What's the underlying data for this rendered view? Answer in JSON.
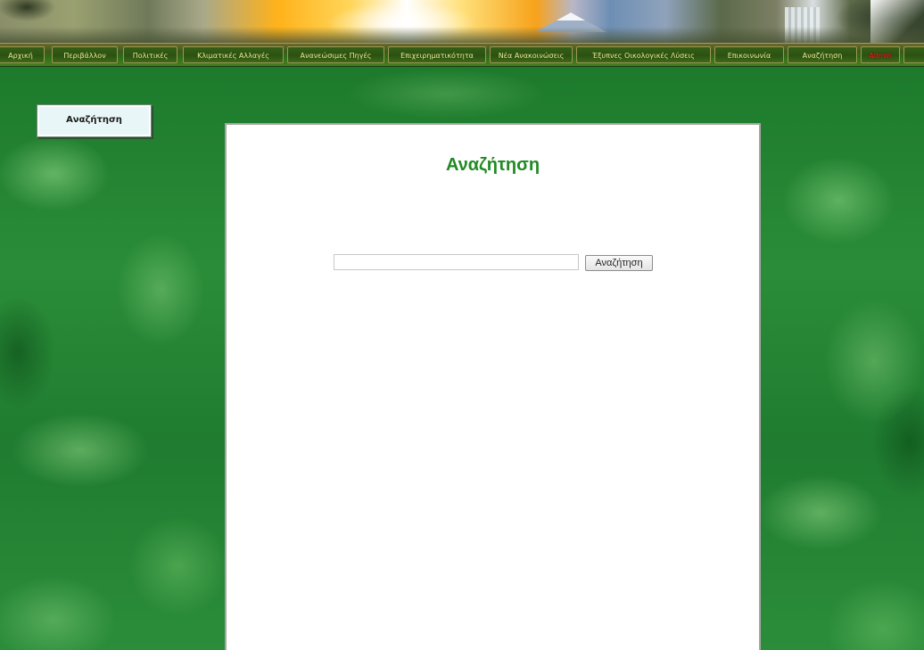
{
  "nav": {
    "items": [
      {
        "label": "Αρχική"
      },
      {
        "label": "Περιβάλλον"
      },
      {
        "label": "Πολιτικές"
      },
      {
        "label": "Κλιματικές Αλλαγές"
      },
      {
        "label": "Ανανεώσιμες Πηγές"
      },
      {
        "label": "Επιχειρηματικότητα"
      },
      {
        "label": "Νέα Ανακοινώσεις"
      },
      {
        "label": "Έξυπνες Οικολογικές Λύσεις"
      },
      {
        "label": "Επικοινωνία"
      },
      {
        "label": "Αναζήτηση"
      },
      {
        "label": "Admin"
      }
    ],
    "admin_color": "#e2211c",
    "label_color": "#e5ea9a"
  },
  "sidebar": {
    "search_button_label": "Αναζήτηση"
  },
  "main": {
    "title": "Αναζήτηση",
    "title_color": "#218a23",
    "search": {
      "value": "",
      "placeholder": "",
      "button_label": "Αναζήτηση"
    }
  }
}
